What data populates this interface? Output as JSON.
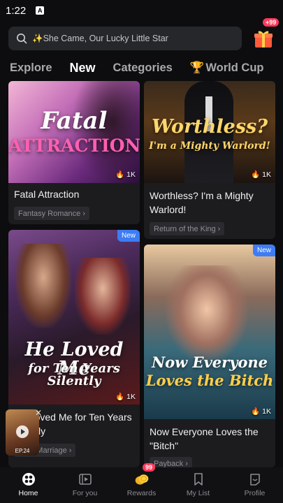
{
  "status": {
    "time": "1:22"
  },
  "search": {
    "text": "✨She Came, Our Lucky Little Star"
  },
  "gift": {
    "badge": "+99"
  },
  "tabs": [
    {
      "label": "Explore"
    },
    {
      "label": "New"
    },
    {
      "label": "Categories"
    },
    {
      "label": "World Cup"
    }
  ],
  "cards": [
    {
      "cover_title_line1": "Fatal",
      "cover_title_line2": "ATTRACTION",
      "views": "1K",
      "title": "Fatal Attraction",
      "genre": "Fantasy Romance"
    },
    {
      "cover_title_line1": "Worthless?",
      "cover_title_line2": "I'm a Mighty Warlord!",
      "views": "1K",
      "title": "Worthless? I'm a Mighty Warlord!",
      "genre": "Return of the King"
    },
    {
      "badge": "New",
      "cover_title_line1": "He Loved Me",
      "cover_title_line2": "for Ten Years Silently",
      "views": "1K",
      "title": "He Loved Me for Ten Years Silently",
      "title_visible": "ved Me for Ten\nSilently",
      "genre": "After Marriage"
    },
    {
      "badge": "New",
      "cover_title_line1": "Now Everyone",
      "cover_title_line2": "Loves the Bitch",
      "views": "1K",
      "title": "Now Everyone Loves the \"Bitch\"",
      "genre": "Payback"
    }
  ],
  "mini_player": {
    "label": "EP.24"
  },
  "nav": {
    "home": "Home",
    "for_you": "For you",
    "rewards": "Rewards",
    "rewards_badge": "99",
    "my_list": "My List",
    "profile": "Profile"
  },
  "colors": {
    "accent_new": "#3d7cf5",
    "badge_red": "#ff3a5c",
    "background": "#0d0d0f"
  }
}
